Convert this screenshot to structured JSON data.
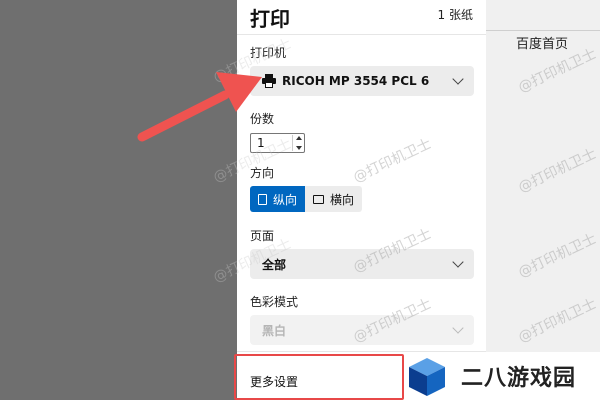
{
  "dialog": {
    "title": "打印",
    "sheet_count": "1 张纸",
    "printer": {
      "label": "打印机",
      "value": "RICOH MP 3554 PCL 6"
    },
    "copies": {
      "label": "份数",
      "value": "1"
    },
    "orientation": {
      "label": "方向",
      "options": [
        "纵向",
        "横向"
      ],
      "selected": "纵向"
    },
    "pages": {
      "label": "页面",
      "value": "全部"
    },
    "color_mode": {
      "label": "色彩模式",
      "value": "黑白"
    },
    "more_settings": "更多设置"
  },
  "background_page": {
    "link": "百度首页"
  },
  "watermark": "@打印机卫士",
  "brand": {
    "text": "二八游戏园"
  },
  "colors": {
    "accent": "#0067c0",
    "highlight_box": "#e84848",
    "arrow": "#ef5350"
  }
}
